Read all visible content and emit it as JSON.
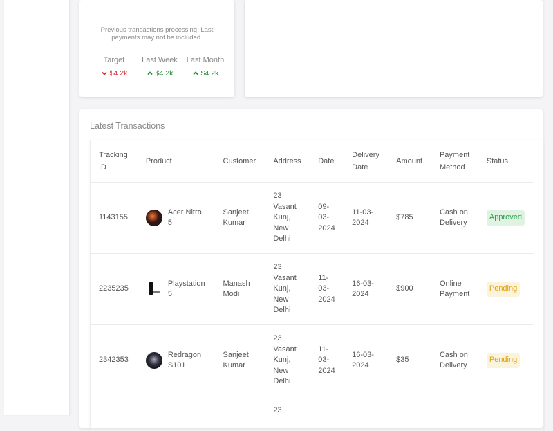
{
  "featured": {
    "note": "Previous transactions processing. Last payments may not be included.",
    "summary": [
      {
        "title": "Target",
        "value": "$4.2k",
        "trend": "down",
        "color": "#d1303a"
      },
      {
        "title": "Last Week",
        "value": "$4.2k",
        "trend": "up",
        "color": "#1f8a3a"
      },
      {
        "title": "Last Month",
        "value": "$4.2k",
        "trend": "up",
        "color": "#1f8a3a"
      }
    ]
  },
  "transactions": {
    "title": "Latest Transactions",
    "headers": [
      "Tracking ID",
      "Product",
      "Customer",
      "Address",
      "Date",
      "Delivery Date",
      "Amount",
      "Payment Method",
      "Status"
    ],
    "rows": [
      {
        "id": "1143155",
        "product": "Acer Nitro 5",
        "customer": "Sanjeet Kumar",
        "address": "23 Vasant Kunj, New Delhi",
        "date": "09-03-2024",
        "delivery": "11-03-2024",
        "amount": "$785",
        "method": "Cash on Delivery",
        "status": "Approved"
      },
      {
        "id": "2235235",
        "product": "Playstation 5",
        "customer": "Manash Modi",
        "address": "23 Vasant Kunj, New Delhi",
        "date": "11-03-2024",
        "delivery": "16-03-2024",
        "amount": "$900",
        "method": "Online Payment",
        "status": "Pending"
      },
      {
        "id": "2342353",
        "product": "Redragon S101",
        "customer": "Sanjeet Kumar",
        "address": "23 Vasant Kunj, New Delhi",
        "date": "11-03-2024",
        "delivery": "16-03-2024",
        "amount": "$35",
        "method": "Cash on Delivery",
        "status": "Pending"
      },
      {
        "address": "23"
      }
    ]
  },
  "colors": {
    "approved": "#2e9d4a",
    "pending": "#e3a008",
    "negative": "#d1303a",
    "positive": "#1f8a3a"
  }
}
